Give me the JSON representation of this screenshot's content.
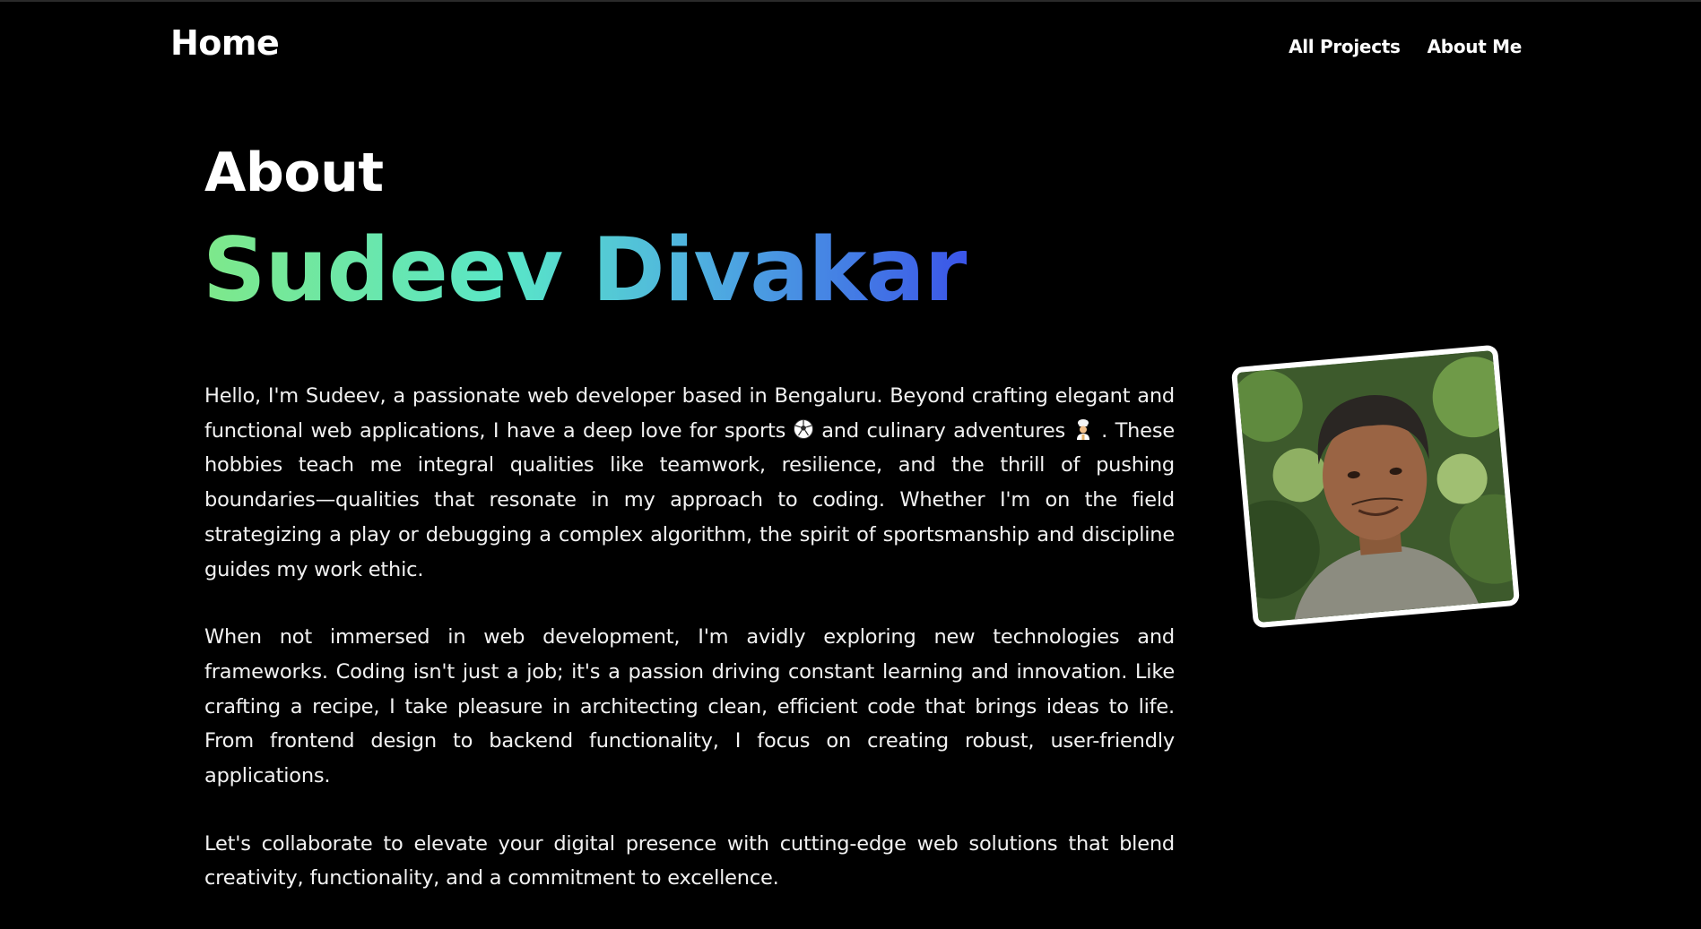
{
  "nav": {
    "brand": "Home",
    "links": [
      "All Projects",
      "About Me"
    ]
  },
  "hero": {
    "about_label": "About",
    "name": "Sudeev Divakar"
  },
  "bio": {
    "p1_a": "Hello, I'm Sudeev, a passionate web developer based in Bengaluru. Beyond crafting elegant and functional web applications, I have a deep love for sports",
    "p1_b": "and culinary adventures",
    "p1_c": ". These hobbies teach me integral qualities like teamwork, resilience, and the thrill of pushing boundaries—qualities that resonate in my approach to coding. Whether I'm on the field strategizing a play or debugging a complex algorithm, the spirit of sportsmanship and discipline guides my work ethic.",
    "p2": "When not immersed in web development, I'm avidly exploring new technologies and frameworks. Coding isn't just a job; it's a passion driving constant learning and innovation. Like crafting a recipe, I take pleasure in architecting clean, efficient code that brings ideas to life. From frontend design to backend functionality, I focus on creating robust, user-friendly applications.",
    "p3": "Let's collaborate to elevate your digital presence with cutting-edge web solutions that blend creativity, functionality, and a commitment to excellence."
  },
  "icons": {
    "sports": "soccer-ball-icon",
    "culinary": "chef-icon"
  },
  "colors": {
    "background": "#000000",
    "text": "#ffffff",
    "gradient_start": "#7ee88a",
    "gradient_mid": "#59e6c8",
    "gradient_end": "#3b55e8"
  }
}
